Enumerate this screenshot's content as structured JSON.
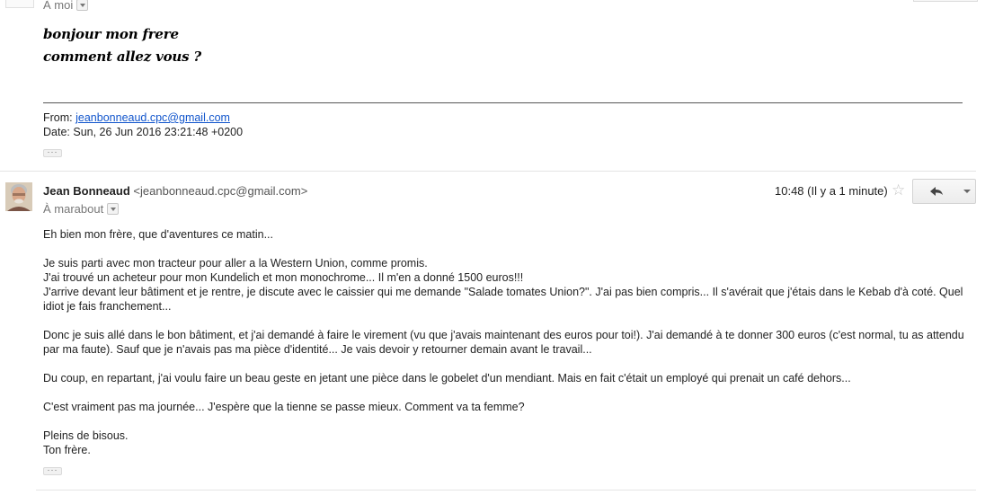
{
  "previous_message": {
    "recipient": "À moi",
    "lines": [
      "bonjour mon frere",
      "comment allez vous ?"
    ],
    "from_label": "From:",
    "from_email": "jeanbonneaud.cpc@gmail.com",
    "date_label": "Date:",
    "date_value": "Sun, 26 Jun 2016 23:21:48 +0200"
  },
  "message": {
    "sender_name": "Jean Bonneaud",
    "sender_email": "<jeanbonneaud.cpc@gmail.com>",
    "recipient": "À marabout",
    "time": "10:48 (Il y a 1 minute)",
    "body": [
      "Eh bien mon frère, que d'aventures ce matin...",
      "Je suis parti avec mon tracteur pour aller a la Western Union, comme promis.",
      "J'ai trouvé un acheteur pour mon Kundelich et mon monochrome... Il m'en a donné 1500 euros!!!",
      "J'arrive devant leur bâtiment et je rentre, je discute avec le caissier qui me demande \"Salade tomates Union?\". J'ai pas bien compris... Il s'avérait que j'étais dans le Kebab d'à coté. Quel idiot je fais franchement...",
      "Donc je suis allé dans le bon bâtiment, et j'ai demandé à faire le virement (vu que j'avais maintenant des euros pour toi!). J'ai demandé à te donner 300 euros (c'est normal, tu as attendu par ma faute). Sauf que je n'avais pas ma pièce d'identité... Je vais devoir y retourner demain avant le travail...",
      "Du coup, en repartant, j'ai voulu faire un beau geste en jetant une pièce dans le gobelet d'un mendiant. Mais en fait c'était un employé qui prenait un café dehors...",
      "C'est vraiment pas ma journée... J'espère que la tienne se passe mieux. Comment va ta femme?",
      "Pleins de bisous.",
      "Ton frère."
    ]
  },
  "icons": {
    "dropdown": "chevron-down-icon",
    "star": "star-icon",
    "reply": "reply-arrow-icon",
    "more": "triangle-down-icon",
    "ellipsis": "show-trimmed-content-icon"
  },
  "colors": {
    "link": "#1155cc",
    "muted": "#777777",
    "separator": "#e5e5e5"
  }
}
